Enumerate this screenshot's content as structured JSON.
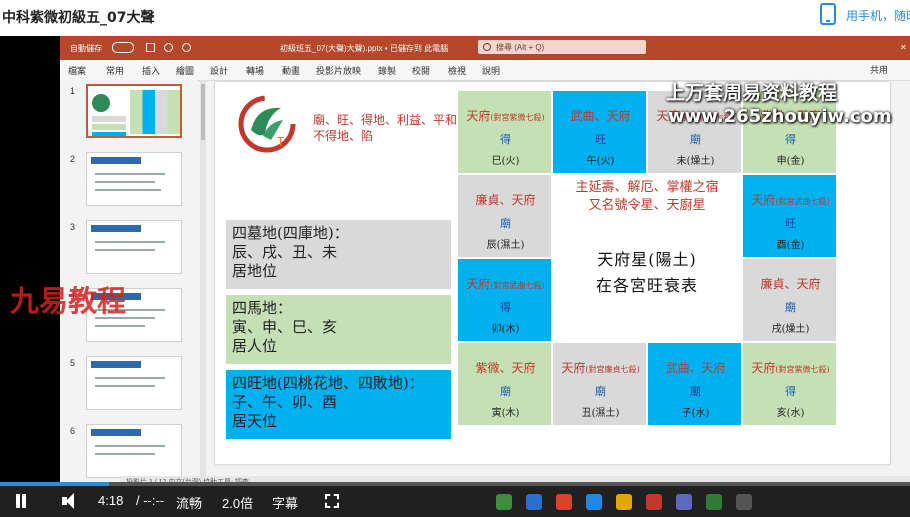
{
  "header": {
    "course_title": "中科紫微初級五_07大聲",
    "phone_link": "用手机，随时"
  },
  "ppt": {
    "filename": "初級班五_07(大聲)大聲).pptx • 已儲存到 此電腦",
    "autosave": "自動儲存",
    "search_placeholder": "搜尋 (Alt + Q)",
    "tabs": [
      "檔案",
      "常用",
      "插入",
      "繪圖",
      "設計",
      "轉場",
      "動畫",
      "投影片放映",
      "錄製",
      "校閱",
      "檢視",
      "說明"
    ],
    "share": "共用",
    "slide_numbers": [
      "1",
      "2",
      "3",
      "4",
      "5",
      "6"
    ],
    "status_text": "投影片 1 / 12    中文(台灣)    協助工具: 調查"
  },
  "slide": {
    "grade_legend": "廟、旺、得地、利益、平和、不得地、陷",
    "boxes": [
      {
        "l1": "四墓地(四庫地)：",
        "l2": "辰、戌、丑、未",
        "l3": "居地位",
        "color": "#d9d9d9"
      },
      {
        "l1": "四馬地：",
        "l2": "寅、申、巳、亥",
        "l3": "居人位",
        "color": "#c5e0b4"
      },
      {
        "l1": "四旺地(四桃花地、四敗地)：",
        "l2": "子、午、卯、酉",
        "l3": "居天位",
        "color": "#00b0f0"
      }
    ],
    "center": {
      "desc1": "主延壽、解厄、掌權之宿",
      "desc2": "又名號令星、天廚星",
      "title1": "天府星(陽土)",
      "title2": "在各宮旺衰表"
    },
    "cells": [
      {
        "star": "天府",
        "note": "(對宮紫微七殺)",
        "grade": "得",
        "branch": "巳(火)",
        "color": "#c5e0b4"
      },
      {
        "star": "武曲、天府",
        "note": "",
        "grade": "旺",
        "branch": "午(火)",
        "color": "#00b0f0"
      },
      {
        "star": "天府",
        "note": "(對宮廉貞七殺)",
        "grade": "廟",
        "branch": "未(燥土)",
        "color": "#d9d9d9"
      },
      {
        "star": "紫微、天府",
        "note": "",
        "grade": "得",
        "branch": "申(金)",
        "color": "#c5e0b4"
      },
      {
        "star": "天府",
        "note": "(對宮武曲七殺)",
        "grade": "旺",
        "branch": "酉(金)",
        "color": "#00b0f0"
      },
      {
        "star": "廉貞、天府",
        "note": "",
        "grade": "廟",
        "branch": "戌(燥土)",
        "color": "#d9d9d9"
      },
      {
        "star": "天府",
        "note": "(對宮紫微七殺)",
        "grade": "得",
        "branch": "亥(水)",
        "color": "#c5e0b4"
      },
      {
        "star": "武曲、天府",
        "note": "",
        "grade": "廟",
        "branch": "子(水)",
        "color": "#00b0f0"
      },
      {
        "star": "天府",
        "note": "(對宮廉貞七殺)",
        "grade": "廟",
        "branch": "丑(濕土)",
        "color": "#d9d9d9"
      },
      {
        "star": "紫微、天府",
        "note": "",
        "grade": "廟",
        "branch": "寅(木)",
        "color": "#c5e0b4"
      },
      {
        "star": "天府",
        "note": "(對宮武曲七殺)",
        "grade": "得",
        "branch": "卯(木)",
        "color": "#00b0f0"
      },
      {
        "star": "廉貞、天府",
        "note": "",
        "grade": "廟",
        "branch": "辰(濕土)",
        "color": "#d9d9d9"
      }
    ]
  },
  "watermarks": {
    "w1": "上万套周易资料教程",
    "w2": "www.265zhouyiw.com",
    "w3": "九易教程"
  },
  "player": {
    "time": "4:18",
    "duration": "/ --:--",
    "quality": "流畅",
    "speed": "2.0倍",
    "subtitle": "字幕",
    "progress": 0.12
  }
}
